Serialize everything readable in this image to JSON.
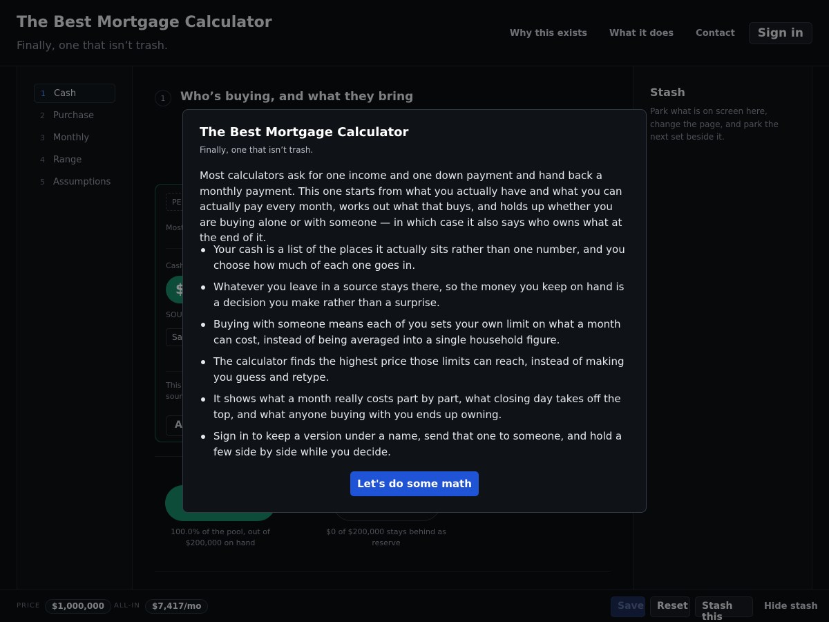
{
  "header": {
    "title": "The Best Mortgage Calculator",
    "subtitle": "Finally, one that isn’t trash.",
    "nav": [
      "Why this exists",
      "What it does",
      "Contact"
    ],
    "signin": "Sign in"
  },
  "sidebar": {
    "steps": [
      {
        "num": "1",
        "label": "Cash",
        "active": true
      },
      {
        "num": "2",
        "label": "Purchase"
      },
      {
        "num": "3",
        "label": "Monthly"
      },
      {
        "num": "4",
        "label": "Range"
      },
      {
        "num": "5",
        "label": "Assumptions"
      }
    ]
  },
  "main": {
    "section_num": "1",
    "section_title": "Who’s buying, and what they bring",
    "card": {
      "tag": "PE",
      "line1": "Most",
      "line2": "Cash",
      "pill": "$",
      "sources_label": "SOUR",
      "select_value": "Sa",
      "note_line1": "This",
      "note_line2": "sour",
      "button": "A"
    },
    "caption_pool": "100.0% of the pool, out of $200,000 on hand",
    "caption_reserve": "$0 of $200,000 stays behind as reserve"
  },
  "stash": {
    "title": "Stash",
    "description": "Park what is on screen here, change the page, and park the next set beside it."
  },
  "bottombar": {
    "price_label": "PRICE",
    "price_value": "$1,000,000",
    "allin_label": "ALL-IN",
    "allin_value": "$7,417/mo",
    "save": "Save",
    "reset": "Reset",
    "stash_this": "Stash this",
    "hide_stash": "Hide stash"
  },
  "modal": {
    "title": "The Best Mortgage Calculator",
    "subtitle": "Finally, one that isn’t trash.",
    "intro": "Most calculators ask for one income and one down payment and hand back a monthly payment. This one starts from what you actually have and what you can actually pay every month, works out what that buys, and holds up whether you are buying alone or with someone — in which case it also says who owns what at the end of it.",
    "bullets": [
      "Your cash is a list of the places it actually sits rather than one number, and you choose how much of each one goes in.",
      "Whatever you leave in a source stays there, so the money you keep on hand is a decision you make rather than a surprise.",
      "Buying with someone means each of you sets your own limit on what a month can cost, instead of being averaged into a single household figure.",
      "The calculator finds the highest price those limits can reach, instead of making you guess and retype.",
      "It shows what a month really costs part by part, what closing day takes off the top, and what anyone buying with you ends up owning.",
      "Sign in to keep a version under a name, send that one to someone, and hold a few side by side while you decide."
    ],
    "cta": "Let's do some math"
  },
  "colors": {
    "background": "#0b0d11",
    "accent": "#1f54d6",
    "positive": "#1b8a6b"
  }
}
